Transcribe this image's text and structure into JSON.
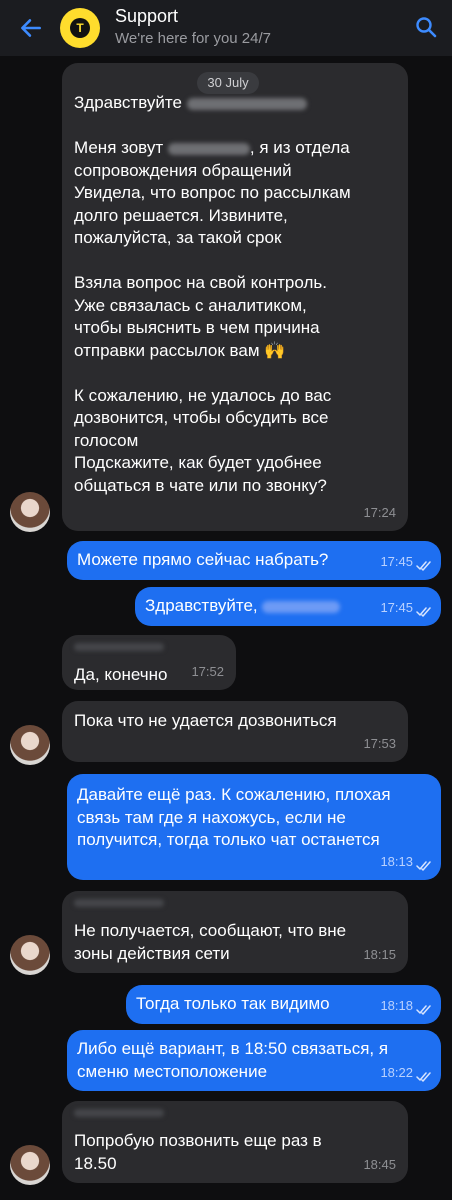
{
  "header": {
    "title": "Support",
    "subtitle": "We're here for you 24/7",
    "logo_letter": "Т"
  },
  "date_chip": "30 July",
  "messages": [
    {
      "dir": "in",
      "lines": [
        "Здравствуйте",
        "",
        "Меня зовут",
        "сопровождения обращений",
        "Увидела, что вопрос по рассылкам",
        "долго решается. Извините,",
        "пожалуйста, за такой срок",
        "",
        "Взяла вопрос на свой контроль.",
        "Уже связалась с аналитиком,",
        "чтобы выяснить в чем причина",
        "отправки рассылок вам 🙌",
        "",
        "К сожалению, не удалось до вас",
        "дозвонится, чтобы обсудить все",
        "голосом",
        "Подскажите, как будет удобнее",
        "общаться в чате или по звонку?"
      ],
      "line3_suffix": ", я из отдела",
      "time": "17:24"
    },
    {
      "dir": "out",
      "text": "Можете прямо сейчас набрать?",
      "time": "17:45"
    },
    {
      "dir": "out",
      "text": "Здравствуйте,",
      "time": "17:45"
    },
    {
      "dir": "in",
      "text": "Да, конечно",
      "time": "17:52"
    },
    {
      "dir": "in",
      "text": "Пока что не удается дозвониться",
      "time": "17:53"
    },
    {
      "dir": "out",
      "text": "Давайте ещё раз. К сожалению, плохая\nсвязь там где я нахожусь, если не\nполучится, тогда только чат останется",
      "time": "18:13"
    },
    {
      "dir": "in",
      "text": "Не получается, сообщают, что вне\nзоны действия сети",
      "time": "18:15"
    },
    {
      "dir": "out",
      "text": "Тогда только так видимо",
      "time": "18:18"
    },
    {
      "dir": "out",
      "text": "Либо ещё вариант, в 18:50 связаться, я\nсменю местоположение",
      "time": "18:22"
    },
    {
      "dir": "in",
      "text": "Попробую позвонить еще раз в\n18.50",
      "time": "18:45"
    }
  ]
}
